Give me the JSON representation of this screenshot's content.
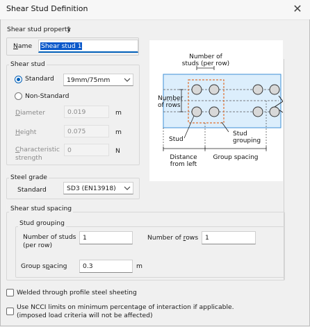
{
  "window": {
    "title": "Shear Stud Definition",
    "close_glyph": "✕"
  },
  "property": {
    "label": "Shear stud property",
    "value": "1"
  },
  "name": {
    "label": "Name",
    "value": "Shear stud 1"
  },
  "shear_stud": {
    "legend": "Shear stud",
    "standard_label": "Standard",
    "standard_selected": true,
    "standard_value": "19mm/75mm",
    "nonstandard_label": "Non-Standard",
    "diameter_label": "Diameter",
    "diameter_value": "0.019",
    "diameter_unit": "m",
    "height_label": "Height",
    "height_value": "0.075",
    "height_unit": "m",
    "strength_label_1": "Characteristic",
    "strength_label_2": "strength",
    "strength_value": "0",
    "strength_unit": "N"
  },
  "steel_grade": {
    "legend": "Steel grade",
    "standard_label": "Standard",
    "value": "SD3 (EN13918)"
  },
  "spacing": {
    "legend": "Shear stud spacing",
    "grouping_legend": "Stud grouping",
    "studs_per_row_label_1": "Number of studs",
    "studs_per_row_label_2": "(per row)",
    "studs_per_row_value": "1",
    "rows_label": "Number of rows",
    "rows_value": "1",
    "group_spacing_label": "Group spacing",
    "group_spacing_value": "0.3",
    "group_spacing_unit": "m"
  },
  "options": {
    "welded_label": "Welded through profile steel sheeting",
    "welded_checked": false,
    "ncci_label_1": "Use NCCI limits on minimum percentage of interaction if applicable.",
    "ncci_label_2": "(imposed load criteria will not be affected)",
    "ncci_checked": false
  },
  "diagram": {
    "studs_per_row_1": "Number of",
    "studs_per_row_2": "studs (per row)",
    "rows_1": "Number",
    "rows_2": "of rows",
    "stud": "Stud",
    "grouping_1": "Stud",
    "grouping_2": "grouping",
    "distance_1": "Distance",
    "distance_2": "from left",
    "group_spacing": "Group spacing",
    "colors": {
      "beam": "#dceefc",
      "beam_edge": "#3c8fd6",
      "group_box": "#e07030"
    }
  }
}
